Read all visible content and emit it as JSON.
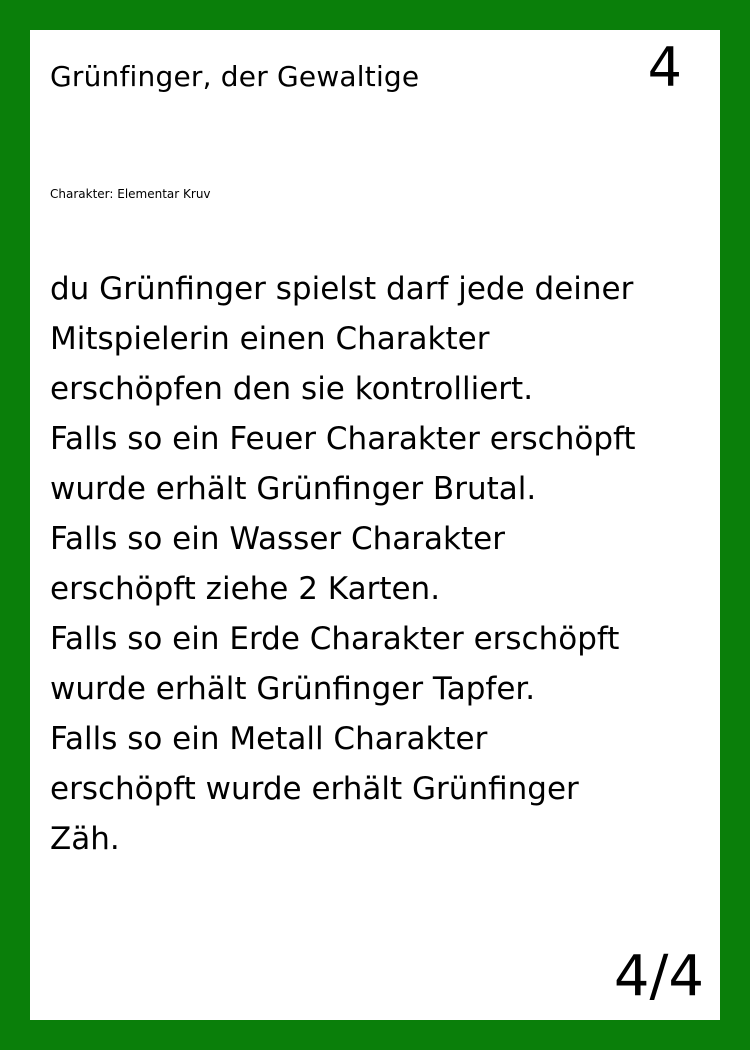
{
  "card": {
    "title": "Grünfinger, der Gewaltige",
    "cost": "4",
    "type_line": "Charakter: Elementar Kruv",
    "rules_lines": [
      "du Grünfinger spielst darf jede deiner",
      "Mitspielerin einen Charakter",
      "erschöpfen den sie kontrolliert.",
      "Falls so ein Feuer Charakter erschöpft",
      "wurde erhält Grünfinger Brutal.",
      "Falls so ein Wasser Charakter",
      "erschöpft ziehe 2 Karten.",
      "Falls so ein Erde Charakter erschöpft",
      "wurde erhält Grünfinger Tapfer.",
      "Falls so ein Metall Charakter",
      "erschöpft wurde erhält Grünfinger",
      "Zäh."
    ],
    "index": "4/4"
  },
  "colors": {
    "border": "#0a7f0a",
    "background": "#ffffff",
    "text": "#000000"
  }
}
